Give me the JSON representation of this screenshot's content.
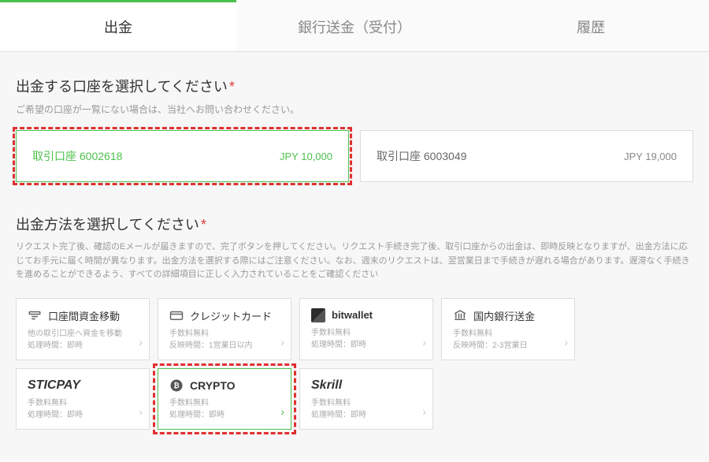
{
  "tabs": {
    "withdraw": "出金",
    "bank_transfer": "銀行送金（受付）",
    "history": "履歴"
  },
  "section_account": {
    "title": "出金する口座を選択してください",
    "sub": "ご希望の口座が一覧にない場合は、当社へお問い合わせください。"
  },
  "accounts": [
    {
      "label": "取引口座 6002618",
      "balance": "JPY 10,000"
    },
    {
      "label": "取引口座 6003049",
      "balance": "JPY 19,000"
    }
  ],
  "section_method": {
    "title": "出金方法を選択してください",
    "desc": "リクエスト完了後、確認のEメールが届きますので、完了ボタンを押してください。リクエスト手続き完了後、取引口座からの出金は、即時反映となりますが、出金方法に応じてお手元に届く時間が異なります。出金方法を選択する際にはご注意ください。なお、週末のリクエストは、翌営業日まで手続きが遅れる場合があります。遅滞なく手続きを進めることができるよう、すべての詳細項目に正しく入力されていることをご確認ください"
  },
  "methods": {
    "transfer": {
      "title": "口座間資金移動",
      "line1": "他の取引口座へ資金を移動",
      "line2": "処理時間：即時"
    },
    "credit": {
      "title": "クレジットカード",
      "line1": "手数料無料",
      "line2": "反映時間：1営業日以内"
    },
    "bitwallet": {
      "title": "bitwallet",
      "line1": "手数料無料",
      "line2": "処理時間：即時"
    },
    "bank": {
      "title": "国内銀行送金",
      "line1": "手数料無料",
      "line2": "反映時間：2-3営業日"
    },
    "sticpay": {
      "title": "STICPAY",
      "line1": "手数料無料",
      "line2": "処理時間：即時"
    },
    "crypto": {
      "title": "CRYPTO",
      "line1": "手数料無料",
      "line2": "処理時間：即時"
    },
    "skrill": {
      "title": "Skrill",
      "line1": "手数料無料",
      "line2": "処理時間：即時"
    }
  }
}
